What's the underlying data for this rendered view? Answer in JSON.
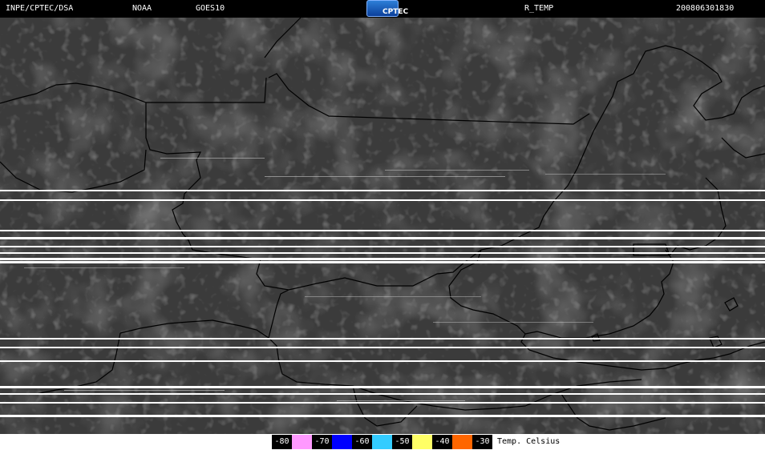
{
  "header": {
    "agency": "INPE/CPTEC/DSA",
    "organization": "NOAA",
    "satellite": "GOES10",
    "product": "R_TEMP",
    "datetime": "200806301830",
    "logo_text": "CPTEC"
  },
  "legend": {
    "entries": [
      {
        "label": "-80",
        "color": "#ff99ff"
      },
      {
        "label": "-70",
        "color": "#0000ff"
      },
      {
        "label": "-60",
        "color": "#33ccff"
      },
      {
        "label": "-50",
        "color": "#ffff66"
      },
      {
        "label": "-40",
        "color": "#ff6600"
      },
      {
        "label": "-30",
        "color": null
      }
    ],
    "caption": "Temp. Celsius"
  },
  "colors": {
    "background": "#3a3a3a",
    "borders": "#000000",
    "scan_lines": "#ffffff"
  }
}
